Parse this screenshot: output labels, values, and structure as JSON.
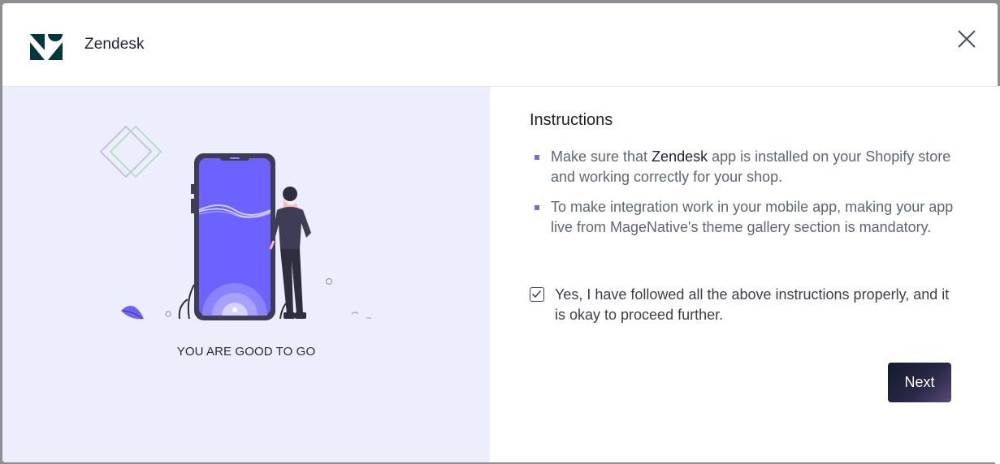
{
  "header": {
    "app_name": "Zendesk",
    "close_icon": "close-icon",
    "logo_icon": "zendesk-logo"
  },
  "left_panel": {
    "caption": "YOU ARE GOOD TO GO",
    "illustration": "phone-and-person-illustration"
  },
  "instructions": {
    "title": "Instructions",
    "items": [
      {
        "pre": "Make sure that ",
        "brand": "Zendesk",
        "post": " app is installed on your Shopify store and working correctly for your shop."
      },
      {
        "text": "To make integration work in your mobile app, making your app live from MageNative's theme gallery section is mandatory."
      }
    ]
  },
  "agreement": {
    "checked": true,
    "label": "Yes, I have followed all the above instructions properly, and it is okay to proceed further."
  },
  "actions": {
    "next_label": "Next"
  },
  "colors": {
    "accent": "#6c6cf0",
    "left_panel_bg": "#ecedfd",
    "button_gradient_start": "#121a2e",
    "button_gradient_end": "#5b4a78"
  }
}
